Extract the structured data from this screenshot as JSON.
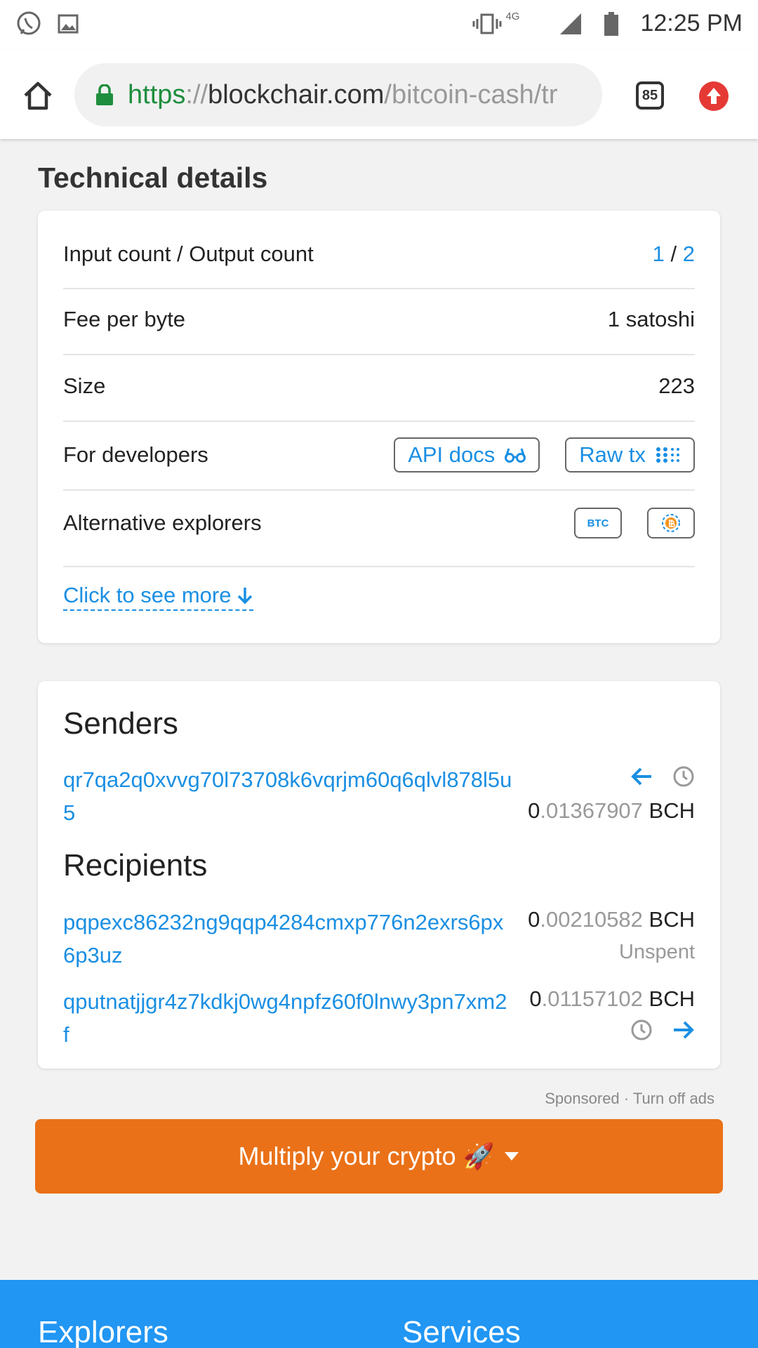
{
  "status_bar": {
    "time": "12:25 PM",
    "network": "4G"
  },
  "browser": {
    "url_scheme": "https",
    "url_separator": "://",
    "url_host": "blockchair.com",
    "url_path": "/bitcoin-cash/tr",
    "tab_count": "85"
  },
  "technical": {
    "title": "Technical details",
    "io_label": "Input count / Output count",
    "input_count": "1",
    "io_sep": " / ",
    "output_count": "2",
    "fee_label": "Fee per byte",
    "fee_value": "1 satoshi",
    "size_label": "Size",
    "size_value": "223",
    "dev_label": "For developers",
    "api_docs": "API docs",
    "raw_tx": "Raw tx",
    "alt_label": "Alternative explorers",
    "alt_btc": "BTC",
    "see_more": "Click to see more"
  },
  "senders": {
    "title": "Senders",
    "items": [
      {
        "address": "qr7qa2q0xvvg70l73708k6vqrjm60q6qlvl878l5u5",
        "amount_int": "0",
        "amount_frac": ".01367907",
        "unit": "BCH"
      }
    ]
  },
  "recipients": {
    "title": "Recipients",
    "items": [
      {
        "address": "pqpexc86232ng9qqp4284cmxp776n2exrs6px6p3uz",
        "amount_int": "0",
        "amount_frac": ".00210582",
        "unit": "BCH",
        "status": "Unspent"
      },
      {
        "address": "qputnatjjgr4z7kdkj0wg4npfz60f0lnwy3pn7xm2f",
        "amount_int": "0",
        "amount_frac": ".01157102",
        "unit": "BCH"
      }
    ]
  },
  "ads": {
    "sponsored": "Sponsored · Turn off ads",
    "promo": "Multiply your crypto 🚀"
  },
  "footer": {
    "col1": "Explorers",
    "col2": "Services"
  },
  "colors": {
    "link": "#1a8fe3",
    "promo": "#ea7118",
    "footer": "#2196f3"
  }
}
